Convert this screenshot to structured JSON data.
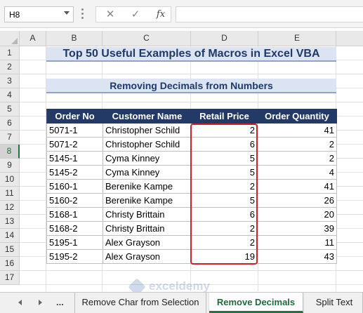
{
  "formula_bar": {
    "name_box": "H8",
    "cancel_icon": "✕",
    "enter_icon": "✓",
    "function_icon": "fx",
    "formula": ""
  },
  "columns": [
    "A",
    "B",
    "C",
    "D",
    "E"
  ],
  "rows": [
    "1",
    "2",
    "3",
    "4",
    "5",
    "6",
    "7",
    "8",
    "9",
    "10",
    "11",
    "12",
    "13",
    "14",
    "15",
    "16",
    "17"
  ],
  "active_row": "8",
  "sheet": {
    "title": "Top 50 Useful Examples of Macros in Excel VBA",
    "subtitle": "Removing Decimals from Numbers",
    "table": {
      "headers": [
        "Order No",
        "Customer Name",
        "Retail Price",
        "Order Quantity"
      ],
      "rows": [
        [
          "5071-1",
          "Christopher Schild",
          "2",
          "41"
        ],
        [
          "5071-2",
          "Christopher Schild",
          "6",
          "2"
        ],
        [
          "5145-1",
          "Cyma Kinney",
          "5",
          "2"
        ],
        [
          "5145-2",
          "Cyma Kinney",
          "5",
          "4"
        ],
        [
          "5160-1",
          "Berenike Kampe",
          "2",
          "41"
        ],
        [
          "5160-2",
          "Berenike Kampe",
          "5",
          "26"
        ],
        [
          "5168-1",
          "Christy Brittain",
          "6",
          "20"
        ],
        [
          "5168-2",
          "Christy Brittain",
          "2",
          "39"
        ],
        [
          "5195-1",
          "Alex Grayson",
          "2",
          "11"
        ],
        [
          "5195-2",
          "Alex Grayson",
          "19",
          "43"
        ]
      ]
    }
  },
  "tabs": {
    "more": "...",
    "items": [
      "Remove Char from Selection",
      "Remove Decimals",
      "Split Text"
    ],
    "active": "Remove Decimals"
  },
  "watermark": {
    "name": "exceldemy",
    "tagline": "EXCEL · DATA · BI"
  },
  "colors": {
    "header_fill": "#243a66",
    "title_fill": "#dce3f2",
    "highlight": "#d0202a",
    "active_tab": "#217346"
  }
}
